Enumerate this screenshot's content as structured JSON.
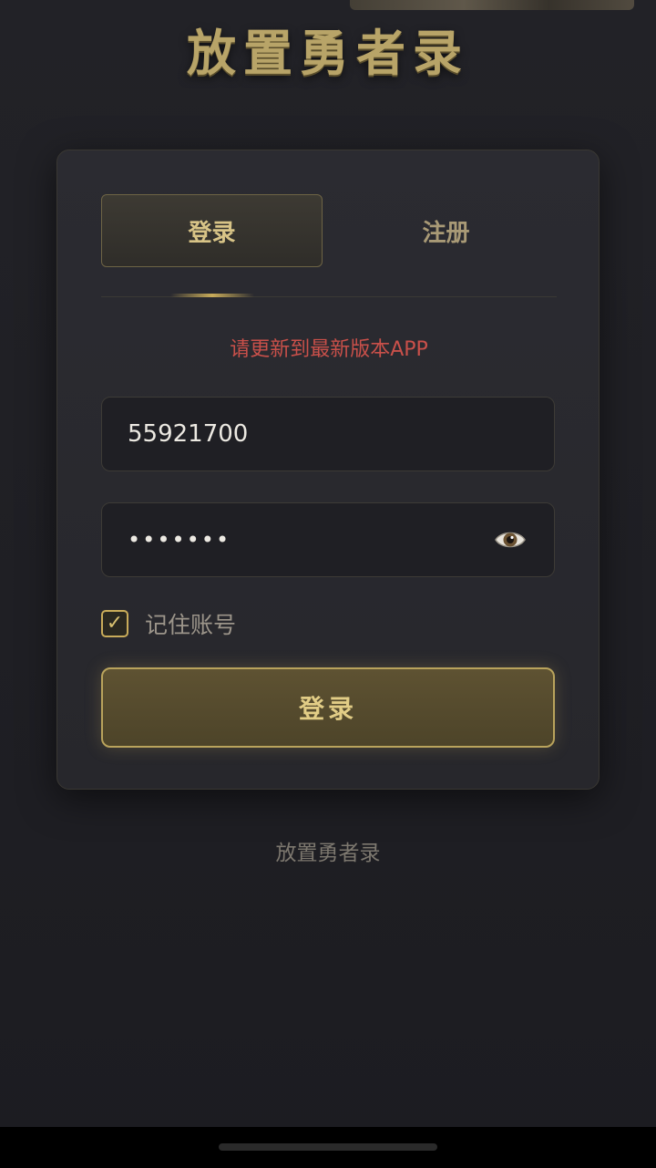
{
  "app": {
    "title": "放置勇者录",
    "footer": "放置勇者录"
  },
  "tabs": [
    {
      "label": "登录",
      "active": true
    },
    {
      "label": "注册",
      "active": false
    }
  ],
  "notice": "请更新到最新版本APP",
  "form": {
    "account_value": "55921700",
    "password_value": "•••••••",
    "password_icon": "eye-icon",
    "remember_label": "记住账号",
    "remember_checked": true,
    "checkmark": "✓",
    "submit_label": "登录"
  },
  "colors": {
    "accent_gold": "#c9ac5a",
    "notice_red": "#c9504a",
    "background": "#1f1f24"
  }
}
